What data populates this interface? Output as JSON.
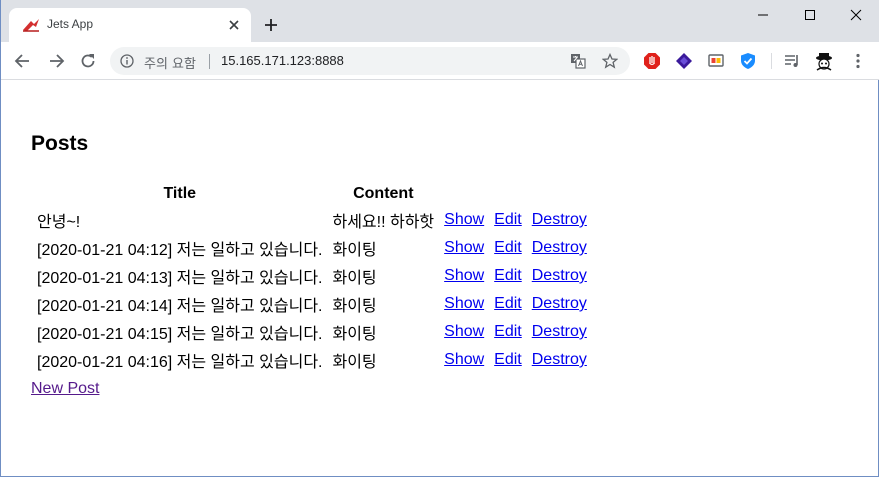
{
  "browser": {
    "tab_title": "Jets App",
    "security_label": "주의 요함",
    "url": "15.165.171.123:8888"
  },
  "page": {
    "title": "Posts",
    "columns": [
      "Title",
      "Content"
    ],
    "rows": [
      {
        "title": "안녕~!",
        "content": "하세요!! 하하핫"
      },
      {
        "title": "[2020-01-21 04:12] 저는 일하고 있습니다.",
        "content": "화이팅"
      },
      {
        "title": "[2020-01-21 04:13] 저는 일하고 있습니다.",
        "content": "화이팅"
      },
      {
        "title": "[2020-01-21 04:14] 저는 일하고 있습니다.",
        "content": "화이팅"
      },
      {
        "title": "[2020-01-21 04:15] 저는 일하고 있습니다.",
        "content": "화이팅"
      },
      {
        "title": "[2020-01-21 04:16] 저는 일하고 있습니다.",
        "content": "화이팅"
      }
    ],
    "actions": {
      "show": "Show",
      "edit": "Edit",
      "destroy": "Destroy"
    },
    "new_post_label": "New Post"
  }
}
